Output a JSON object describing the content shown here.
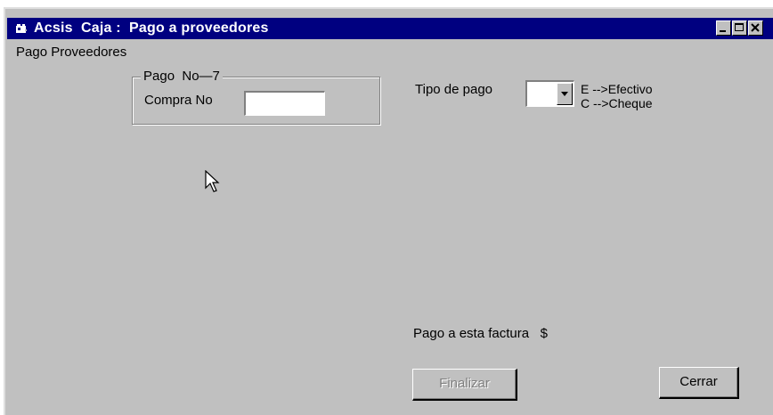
{
  "window": {
    "title": "Acsis  Caja :  Pago a proveedores",
    "icon": "app-icon"
  },
  "form": {
    "heading": "Pago Proveedores",
    "group": {
      "caption": "Pago  No—7",
      "compra_label": "Compra No",
      "compra_value": ""
    },
    "tipo_pago": {
      "label": "Tipo de pago",
      "selected": "",
      "legend": [
        "E -->Efectivo",
        "C -->Cheque"
      ]
    },
    "pago_label": "Pago a esta factura   $",
    "buttons": {
      "finalizar": "Finalizar",
      "cerrar": "Cerrar"
    }
  },
  "colors": {
    "titlebar": "#000080",
    "face": "#c0c0c0"
  }
}
